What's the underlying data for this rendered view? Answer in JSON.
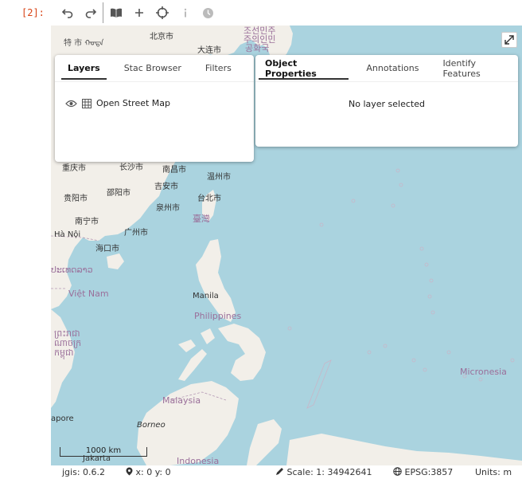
{
  "cell": {
    "prompt": "[2]:"
  },
  "toolbar": {
    "buttons": [
      "undo-icon",
      "redo-icon",
      "book-icon",
      "plus-icon",
      "crosshair-icon",
      "info-icon",
      "clock-icon"
    ]
  },
  "map": {
    "labels": [
      {
        "text": "特 市 ᠬᠣᠲᠠ",
        "kind": "city"
      },
      {
        "text": "北京市",
        "kind": "city"
      },
      {
        "text": "조선민주",
        "kind": "country"
      },
      {
        "text": "주의인민",
        "kind": "country"
      },
      {
        "text": "공화국",
        "kind": "country"
      },
      {
        "text": "大连市",
        "kind": "city"
      },
      {
        "text": "重庆市",
        "kind": "city"
      },
      {
        "text": "长沙市",
        "kind": "city"
      },
      {
        "text": "南昌市",
        "kind": "city"
      },
      {
        "text": "温州市",
        "kind": "city"
      },
      {
        "text": "邵阳市",
        "kind": "city"
      },
      {
        "text": "吉安市",
        "kind": "city"
      },
      {
        "text": "贵阳市",
        "kind": "city"
      },
      {
        "text": "台北市",
        "kind": "city"
      },
      {
        "text": "泉州市",
        "kind": "city"
      },
      {
        "text": "臺灣",
        "kind": "country"
      },
      {
        "text": "南宁市",
        "kind": "city"
      },
      {
        "text": "广州市",
        "kind": "city"
      },
      {
        "text": "Hà Nội",
        "kind": "city"
      },
      {
        "text": "海口市",
        "kind": "city"
      },
      {
        "text": "ປະເທດລາວ",
        "kind": "country"
      },
      {
        "text": "Việt Nam",
        "kind": "country"
      },
      {
        "text": "Manila",
        "kind": "city"
      },
      {
        "text": "Philippines",
        "kind": "country"
      },
      {
        "text": "ព្រះរាជា",
        "kind": "country"
      },
      {
        "text": "ណាចក្រ",
        "kind": "country"
      },
      {
        "text": "កម្ពុជា",
        "kind": "country"
      },
      {
        "text": "Micronesia",
        "kind": "country"
      },
      {
        "text": "Malaysia",
        "kind": "country"
      },
      {
        "text": "Borneo",
        "kind": "city"
      },
      {
        "text": "apore",
        "kind": "city"
      },
      {
        "text": "Indonesia",
        "kind": "country"
      },
      {
        "text": "Jakarta",
        "kind": "city"
      }
    ],
    "scalebar": "1000 km"
  },
  "layers_panel": {
    "tabs": [
      "Layers",
      "Stac Browser",
      "Filters"
    ],
    "active_tab": "Layers",
    "layers": [
      {
        "name": "Open Street Map"
      }
    ]
  },
  "properties_panel": {
    "tabs": [
      "Object Properties",
      "Annotations",
      "Identify Features"
    ],
    "active_tab": "Object Properties",
    "message": "No layer selected"
  },
  "status": {
    "version": "jgis: 0.6.2",
    "coords": "x: 0 y: 0",
    "scale": "Scale: 1: 34942641",
    "projection": "EPSG:3857",
    "units": "Units: m"
  }
}
